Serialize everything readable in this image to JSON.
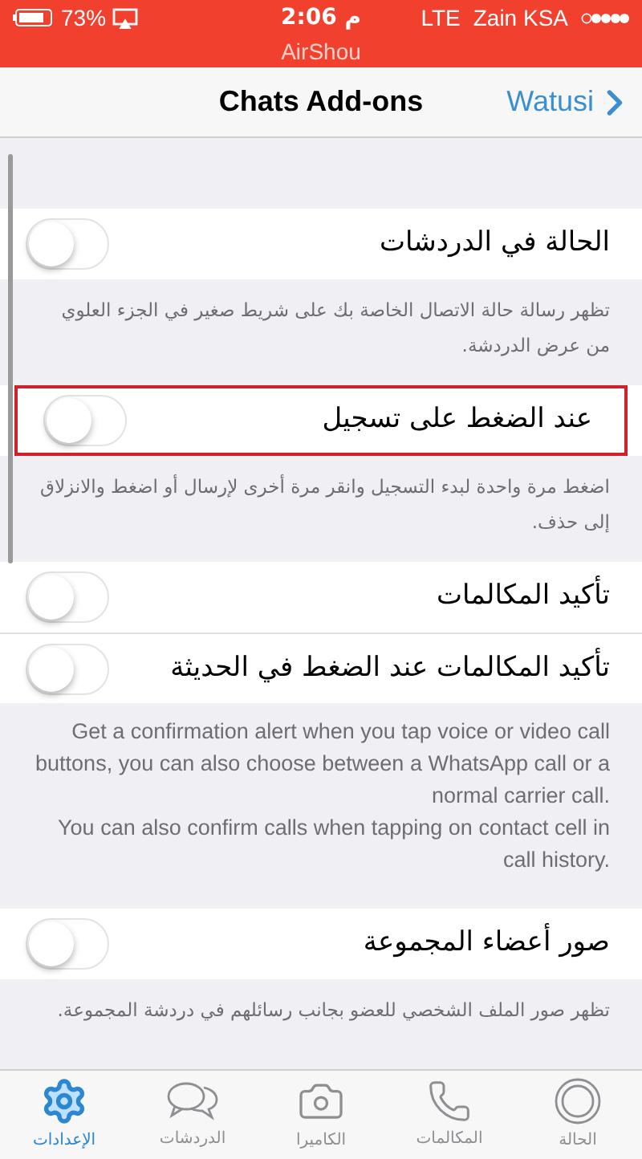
{
  "status_bar": {
    "battery": "73%",
    "time": "م 2:06",
    "network": "LTE",
    "carrier": "Zain KSA",
    "recording_app": "AirShou"
  },
  "nav": {
    "title": "Chats Add-ons",
    "back": "Watusi"
  },
  "sections": [
    {
      "rows": [
        {
          "label": "الحالة في الدردشات",
          "on": false,
          "highlighted": false
        }
      ],
      "footer": "تظهر رسالة حالة الاتصال الخاصة بك على شريط صغير في الجزء العلوي من عرض الدردشة.",
      "kind": "arabic"
    },
    {
      "rows": [
        {
          "label": "عند الضغط على تسجيل",
          "on": false,
          "highlighted": true
        }
      ],
      "footer": "اضغط مرة واحدة لبدء التسجيل وانقر مرة أخرى لإرسال أو اضغط والانزلاق إلى حذف.",
      "kind": "arabic"
    },
    {
      "rows": [
        {
          "label": "تأكيد المكالمات",
          "on": false,
          "highlighted": false
        },
        {
          "label": "تأكيد المكالمات عند الضغط في الحديثة",
          "on": false,
          "highlighted": false
        }
      ],
      "footer": "Get a confirmation alert when you tap voice or video call buttons, you can also choose between a WhatsApp call or a normal carrier call.\nYou can also confirm calls when tapping on contact cell in call history.",
      "kind": "english"
    },
    {
      "rows": [
        {
          "label": "صور أعضاء المجموعة",
          "on": false,
          "highlighted": false
        }
      ],
      "footer": "تظهر صور الملف الشخصي للعضو بجانب رسائلهم في دردشة المجموعة.",
      "kind": "arabic"
    }
  ],
  "tab_bar": [
    {
      "kind": "status",
      "label": "الحالة",
      "selected": false
    },
    {
      "kind": "calls",
      "label": "المكالمات",
      "selected": false
    },
    {
      "kind": "camera",
      "label": "الكاميرا",
      "selected": false
    },
    {
      "kind": "chats",
      "label": "الدردشات",
      "selected": false
    },
    {
      "kind": "settings",
      "label": "الإعدادات",
      "selected": true
    }
  ]
}
